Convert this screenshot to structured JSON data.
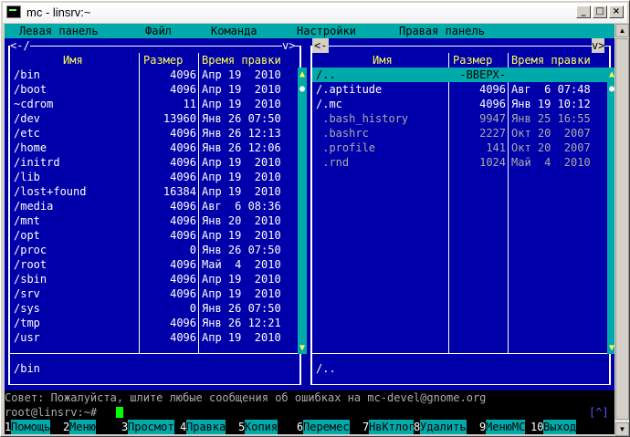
{
  "window": {
    "title": "mc - linsrv:~"
  },
  "menu": [
    "Левая панель",
    "Файл",
    "Команда",
    "Настройки",
    "Правая панель"
  ],
  "left_panel": {
    "path_top": "<-/",
    "path_right": "v>",
    "headers": [
      "Имя",
      "Размер",
      "Время правки"
    ],
    "rows": [
      [
        "/bin",
        "4096",
        "Апр 19  2010"
      ],
      [
        "/boot",
        "4096",
        "Апр 19  2010"
      ],
      [
        "~cdrom",
        "11",
        "Апр 19  2010"
      ],
      [
        "/dev",
        "13960",
        "Янв 26 07:50"
      ],
      [
        "/etc",
        "4096",
        "Янв 26 12:13"
      ],
      [
        "/home",
        "4096",
        "Янв 26 12:06"
      ],
      [
        "/initrd",
        "4096",
        "Апр 19  2010"
      ],
      [
        "/lib",
        "4096",
        "Апр 19  2010"
      ],
      [
        "/lost+found",
        "16384",
        "Апр 19  2010"
      ],
      [
        "/media",
        "4096",
        "Авг  6 08:36"
      ],
      [
        "/mnt",
        "4096",
        "Янв 20  2010"
      ],
      [
        "/opt",
        "4096",
        "Апр 19  2010"
      ],
      [
        "/proc",
        "0",
        "Янв 26 07:50"
      ],
      [
        "/root",
        "4096",
        "Май  4  2010"
      ],
      [
        "/sbin",
        "4096",
        "Апр 19  2010"
      ],
      [
        "/srv",
        "4096",
        "Апр 19  2010"
      ],
      [
        "/sys",
        "0",
        "Янв 26 07:50"
      ],
      [
        "/tmp",
        "4096",
        "Янв 26 12:21"
      ],
      [
        "/usr",
        "4096",
        "Апр 19  2010"
      ]
    ],
    "mini_status": "/bin"
  },
  "right_panel": {
    "path_top": "<-",
    "path_right": "v>",
    "headers": [
      "Имя",
      "Размер",
      "Время правки"
    ],
    "rows": [
      {
        "name": "/..",
        "size": "-ВВЕРХ-",
        "time": "",
        "style": "sel"
      },
      {
        "name": "/.aptitude",
        "size": "4096",
        "time": "Авг  6 07:48",
        "style": "dir"
      },
      {
        "name": "/.mc",
        "size": "4096",
        "time": "Янв 19 10:12",
        "style": "dir"
      },
      {
        "name": " .bash_history",
        "size": "9947",
        "time": "Янв 25 16:55",
        "style": "file"
      },
      {
        "name": " .bashrc",
        "size": "2227",
        "time": "Окт 20  2007",
        "style": "file"
      },
      {
        "name": " .profile",
        "size": "141",
        "time": "Окт 20  2007",
        "style": "file"
      },
      {
        "name": " .rnd",
        "size": "1024",
        "time": "Май  4  2010",
        "style": "file"
      }
    ],
    "mini_status": "/.."
  },
  "hint": "Совет: Пожалуйста, шлите любые сообщения об ошибках на mc-devel@gnome.org",
  "prompt": "root@linsrv:~#",
  "prompt_tag": "[^]",
  "keys": [
    {
      "n": "1",
      "l": "Помощь"
    },
    {
      "n": "2",
      "l": "Меню"
    },
    {
      "n": "3",
      "l": "Просмот"
    },
    {
      "n": "4",
      "l": "Правка"
    },
    {
      "n": "5",
      "l": "Копия"
    },
    {
      "n": "6",
      "l": "Перемес"
    },
    {
      "n": "7",
      "l": "НвКтлог"
    },
    {
      "n": "8",
      "l": "Удалить"
    },
    {
      "n": "9",
      "l": "МенюMC"
    },
    {
      "n": "10",
      "l": "Выход"
    }
  ],
  "colors": {
    "panel_bg": "#0000aa",
    "accent": "#00aaaa",
    "highlight_text": "#ffff55"
  }
}
